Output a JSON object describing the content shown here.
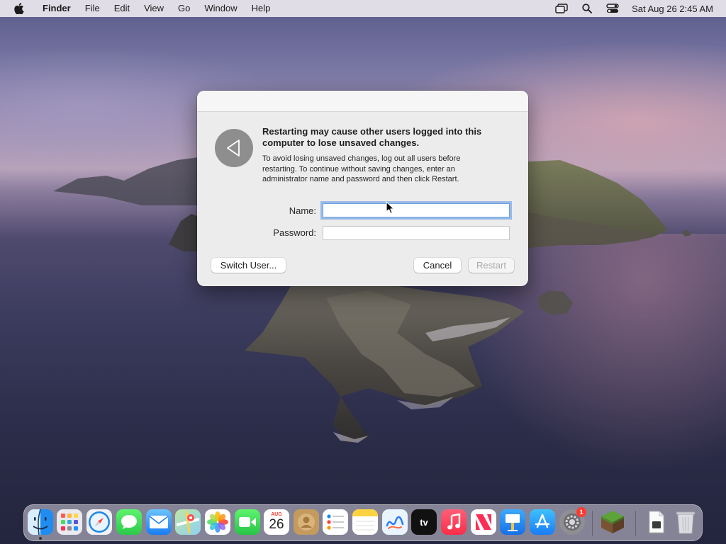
{
  "menubar": {
    "app_name": "Finder",
    "items": [
      "File",
      "Edit",
      "View",
      "Go",
      "Window",
      "Help"
    ],
    "clock": "Sat Aug 26  2:45 AM",
    "status_icons": [
      "screen-mirroring-icon",
      "search-icon",
      "control-center-icon"
    ]
  },
  "dialog": {
    "heading": "Restarting may cause other users logged into this computer to lose unsaved changes.",
    "body": "To avoid losing unsaved changes, log out all users before restarting. To continue without saving changes, enter an administrator name and password and then click Restart.",
    "name_label": "Name:",
    "name_value": "",
    "password_label": "Password:",
    "password_value": "",
    "switch_user_label": "Switch User...",
    "cancel_label": "Cancel",
    "restart_label": "Restart",
    "restart_enabled": false,
    "icon": "restart-arrow-icon"
  },
  "dock": {
    "items": [
      {
        "name": "finder",
        "running": true
      },
      {
        "name": "launchpad"
      },
      {
        "name": "safari"
      },
      {
        "name": "messages"
      },
      {
        "name": "mail"
      },
      {
        "name": "maps"
      },
      {
        "name": "photos"
      },
      {
        "name": "facetime"
      },
      {
        "name": "calendar",
        "month": "AUG",
        "day": "26"
      },
      {
        "name": "contacts"
      },
      {
        "name": "reminders"
      },
      {
        "name": "notes"
      },
      {
        "name": "freeform"
      },
      {
        "name": "apple-tv",
        "label": "tv"
      },
      {
        "name": "music"
      },
      {
        "name": "news"
      },
      {
        "name": "keynote"
      },
      {
        "name": "app-store"
      },
      {
        "name": "system-settings",
        "badge": "1"
      },
      {
        "name": "minecraft"
      },
      {
        "name": "downloads-stack"
      },
      {
        "name": "trash"
      }
    ]
  },
  "colors": {
    "accent": "#3b82f6",
    "badge": "#ff3b30",
    "dialog_bg": "#ececec"
  }
}
